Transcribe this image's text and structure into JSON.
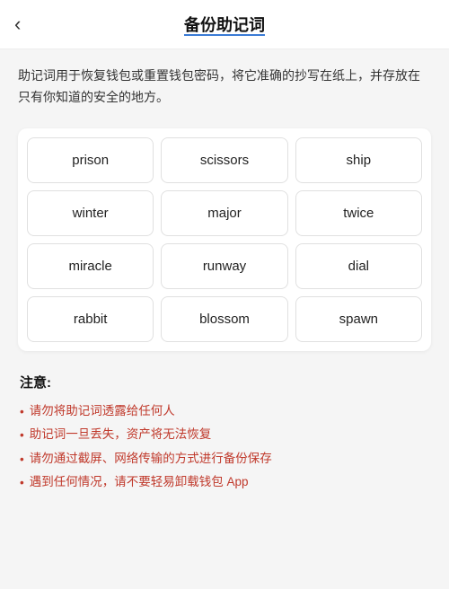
{
  "header": {
    "back_label": "‹",
    "title": "备份助记词"
  },
  "description": "助记词用于恢复钱包或重置钱包密码，将它准确的抄写在纸上，并存放在只有你知道的安全的地方。",
  "mnemonic_grid": {
    "words": [
      "prison",
      "scissors",
      "ship",
      "winter",
      "major",
      "twice",
      "miracle",
      "runway",
      "dial",
      "rabbit",
      "blossom",
      "spawn"
    ]
  },
  "notice": {
    "title": "注意:",
    "items": [
      "请勿将助记词透露给任何人",
      "助记词一旦丢失，资产将无法恢复",
      "请勿通过截屏、网络传输的方式进行备份保存",
      "遇到任何情况，请不要轻易卸载钱包 App"
    ]
  }
}
